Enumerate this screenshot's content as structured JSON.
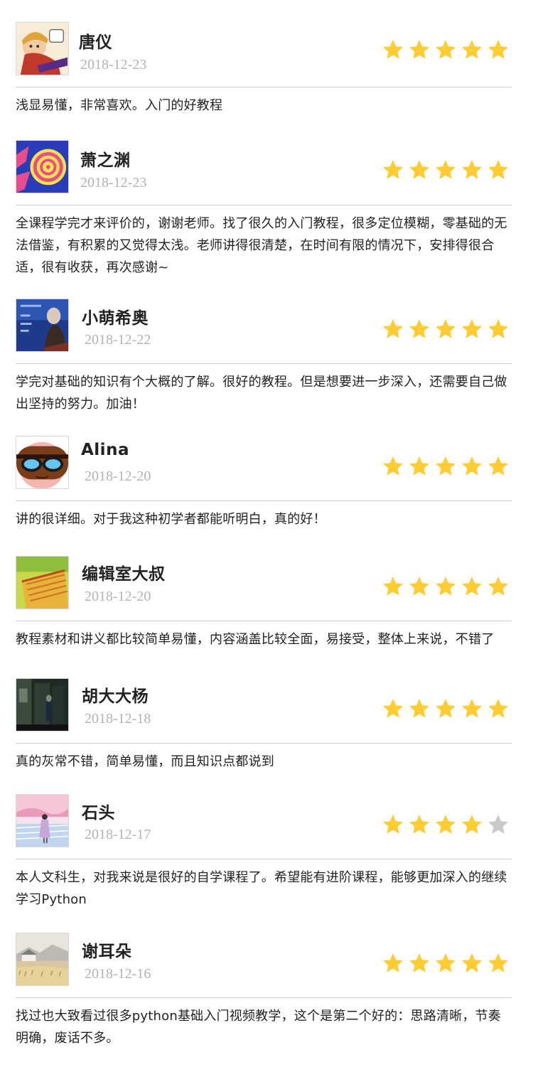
{
  "colors": {
    "star_filled": "#ffcc33",
    "star_empty": "#c9c9c9",
    "date": "#b3b3b3",
    "divider": "#cfcfcf"
  },
  "icons": {
    "star": "star-icon"
  },
  "reviews": [
    {
      "name": "唐仪",
      "date": "2018-12-23",
      "rating": 5,
      "comment": "浅显易懂，非常喜欢。入门的好教程"
    },
    {
      "name": "萧之渊",
      "date": "2018-12-23",
      "rating": 5,
      "comment": "全课程学完才来评价的，谢谢老师。找了很久的入门教程，很多定位模糊，零基础的无法借鉴，有积累的又觉得太浅。老师讲得很清楚，在时间有限的情况下，安排得很合适，很有收获，再次感谢~"
    },
    {
      "name": "小萌希奥",
      "date": "2018-12-22",
      "rating": 5,
      "comment": "学完对基础的知识有个大概的了解。很好的教程。但是想要进一步深入，还需要自己做出坚持的努力。加油！"
    },
    {
      "name": "Alina",
      "date": "2018-12-20",
      "rating": 5,
      "comment": "讲的很详细。对于我这种初学者都能听明白，真的好！"
    },
    {
      "name": "编辑室大叔",
      "date": "2018-12-20",
      "rating": 5,
      "comment": "教程素材和讲义都比较简单易懂，内容涵盖比较全面，易接受，整体上来说，不错了"
    },
    {
      "name": "胡大大杨",
      "date": "2018-12-18",
      "rating": 5,
      "comment": "真的灰常不错，简单易懂，而且知识点都说到"
    },
    {
      "name": "石头",
      "date": "2018-12-17",
      "rating": 4,
      "comment": "本人文科生，对我来说是很好的自学课程了。希望能有进阶课程，能够更加深入的继续学习Python"
    },
    {
      "name": "谢耳朵",
      "date": "2018-12-16",
      "rating": 5,
      "comment": "找过也大致看过很多python基础入门视频教学，这个是第二个好的：思路清晰，节奏明确，废话不多。"
    }
  ]
}
